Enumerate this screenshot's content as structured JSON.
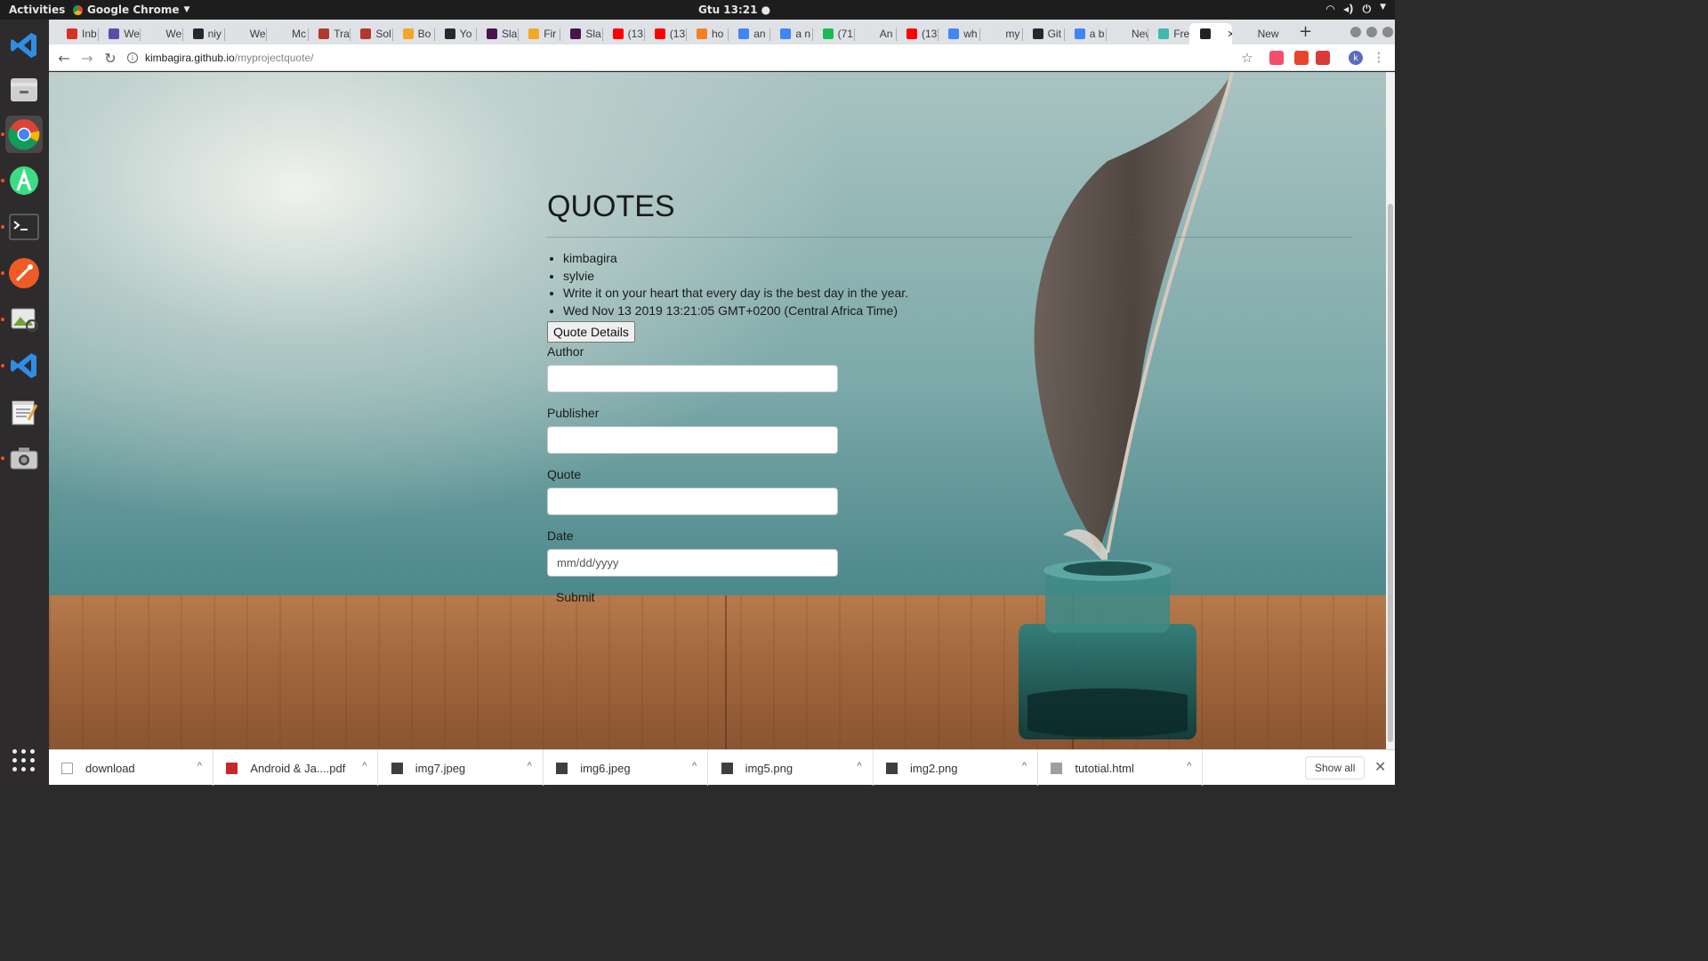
{
  "topbar": {
    "activities": "Activities",
    "app_name": "Google Chrome",
    "clock": "Gtu 13:21 ●"
  },
  "dock": {
    "items": [
      {
        "icon": "vscode-icon",
        "color": "#2f7bd2"
      },
      {
        "icon": "file-manager-icon",
        "color": "#d9d9d9"
      },
      {
        "icon": "chrome-icon",
        "color": "#dd4b39"
      },
      {
        "icon": "android-studio-icon",
        "color": "#3ddc84"
      },
      {
        "icon": "terminal-icon",
        "color": "#222222"
      },
      {
        "icon": "postman-icon",
        "color": "#ef5b25"
      },
      {
        "icon": "image-viewer-icon",
        "color": "#8ac14b"
      },
      {
        "icon": "vscode-icon",
        "color": "#2f7bd2"
      },
      {
        "icon": "text-editor-icon",
        "color": "#f4f4f4"
      },
      {
        "icon": "screenshot-icon",
        "color": "#c9c9c9"
      }
    ]
  },
  "tabs": [
    {
      "label": "Inb",
      "color": "#d93025"
    },
    {
      "label": "We",
      "color": "#5b4ca8"
    },
    {
      "label": "We",
      "color": "#e0e0e0"
    },
    {
      "label": "niy",
      "color": "#24292e"
    },
    {
      "label": "We",
      "color": "#e0e0e0"
    },
    {
      "label": "Mc",
      "color": "#e0e0e0"
    },
    {
      "label": "Tra",
      "color": "#b03a2e"
    },
    {
      "label": "Sol",
      "color": "#b03a2e"
    },
    {
      "label": "Bo",
      "color": "#f5a623"
    },
    {
      "label": "Yo",
      "color": "#24292e"
    },
    {
      "label": "Sla",
      "color": "#4a154b"
    },
    {
      "label": "Fir",
      "color": "#f5a623"
    },
    {
      "label": "Sla",
      "color": "#4a154b"
    },
    {
      "label": "(13",
      "color": "#ff0000"
    },
    {
      "label": "(13",
      "color": "#ff0000"
    },
    {
      "label": "ho",
      "color": "#f48024"
    },
    {
      "label": "an",
      "color": "#4285f4"
    },
    {
      "label": "a n",
      "color": "#4285f4"
    },
    {
      "label": "(71",
      "color": "#1db954"
    },
    {
      "label": "An",
      "color": "#e0e0e0"
    },
    {
      "label": "(13",
      "color": "#ff0000"
    },
    {
      "label": "wh",
      "color": "#4285f4"
    },
    {
      "label": "my",
      "color": "#e0e0e0"
    },
    {
      "label": "Git",
      "color": "#24292e"
    },
    {
      "label": "a b",
      "color": "#4285f4"
    },
    {
      "label": "New T",
      "color": "#dee1e6"
    },
    {
      "label": "Fre",
      "color": "#3fb8af"
    },
    {
      "label": "",
      "color": "#222222"
    },
    {
      "label": "New T",
      "color": "#dee1e6"
    }
  ],
  "address": {
    "host": "kimbagira.github.io",
    "path": "/myprojectquote/"
  },
  "page": {
    "title": "QUOTES",
    "quote_items": [
      "kimbagira",
      "sylvie",
      "Write it on your heart that every day is the best day in the year.",
      "Wed Nov 13 2019 13:21:05 GMT+0200 (Central Africa Time)"
    ],
    "details_button": "Quote Details",
    "form": {
      "author_label": "Author",
      "publisher_label": "Publisher",
      "quote_label": "Quote",
      "date_label": "Date",
      "date_placeholder": "mm/dd/yyyy",
      "submit_label": "Submit"
    }
  },
  "downloads": [
    {
      "name": "download",
      "icon": "file-icon"
    },
    {
      "name": "Android & Ja....pdf",
      "icon": "pdf-icon"
    },
    {
      "name": "img7.jpeg",
      "icon": "image-icon"
    },
    {
      "name": "img6.jpeg",
      "icon": "image-icon"
    },
    {
      "name": "img5.png",
      "icon": "image-icon"
    },
    {
      "name": "img2.png",
      "icon": "image-icon"
    },
    {
      "name": "tutotial.html",
      "icon": "html-file-icon"
    }
  ],
  "shelf": {
    "show_all": "Show all"
  }
}
